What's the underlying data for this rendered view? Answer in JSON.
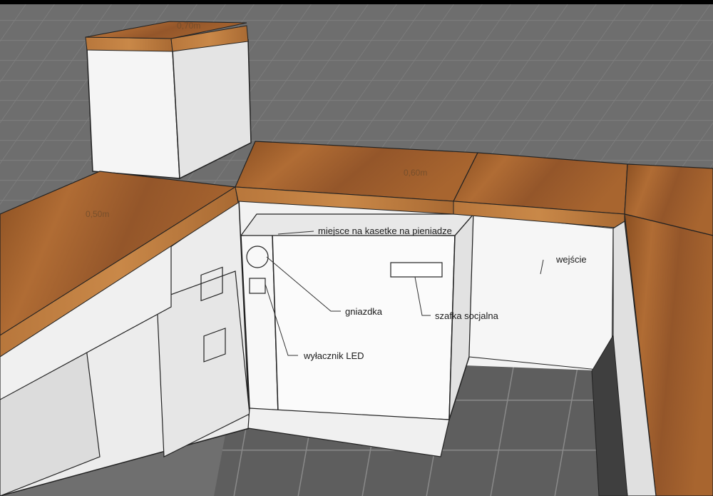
{
  "annotations": {
    "cash_box": "miejsce na kasetke na pieniadze",
    "socket": "gniazdka",
    "led_switch": "wyłacznik LED",
    "social_cabinet": "szafka socjalna",
    "entrance": "wejście"
  },
  "dimensions": {
    "left_counter": "0,50m",
    "middle_counter": "0,60m",
    "top_cabinet": "0,70m"
  },
  "colors": {
    "floor": "#6b6b6b",
    "wood": "#9a5c2a",
    "cabinet": "#f4f4f4"
  }
}
